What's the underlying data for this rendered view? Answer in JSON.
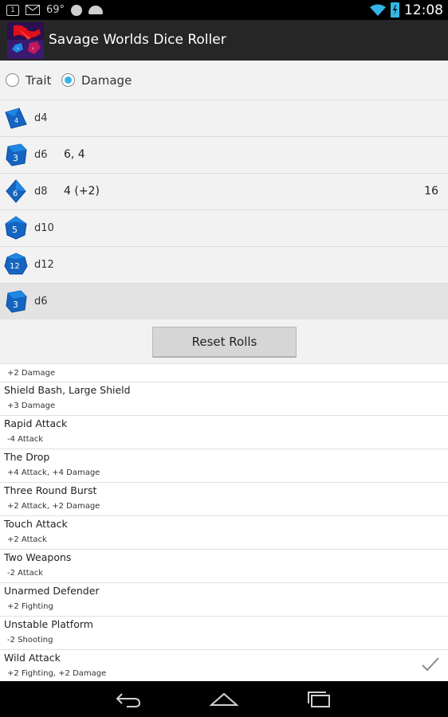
{
  "status_bar": {
    "notification_count": "1",
    "temperature": "69°",
    "time": "12:08",
    "icons": [
      "notification-badge-icon",
      "mail-icon",
      "hangouts-icon",
      "android-icon",
      "wifi-icon",
      "battery-charging-icon"
    ]
  },
  "app": {
    "title": "Savage Worlds Dice Roller",
    "icon": "app-logo-icon"
  },
  "mode": {
    "options": [
      {
        "label": "Trait",
        "selected": false
      },
      {
        "label": "Damage",
        "selected": true
      }
    ]
  },
  "dice": [
    {
      "name": "d4",
      "result": "",
      "total": "",
      "icon": "d4-die-icon",
      "face": "4"
    },
    {
      "name": "d6",
      "result": "6, 4",
      "total": "",
      "icon": "d6-die-icon",
      "face": "3"
    },
    {
      "name": "d8",
      "result": "4 (+2)",
      "total": "16",
      "icon": "d8-die-icon",
      "face": "6"
    },
    {
      "name": "d10",
      "result": "",
      "total": "",
      "icon": "d10-die-icon",
      "face": "5"
    },
    {
      "name": "d12",
      "result": "",
      "total": "",
      "icon": "d12-die-icon",
      "face": "12"
    },
    {
      "name": "d6",
      "result": "",
      "total": "",
      "icon": "d6-die-icon",
      "face": "3",
      "selected": true
    }
  ],
  "reset_label": "Reset Rolls",
  "modifiers": [
    {
      "title": "",
      "subtitle": "+2 Damage",
      "checked": false
    },
    {
      "title": "Shield Bash, Large Shield",
      "subtitle": "+3 Damage",
      "checked": false
    },
    {
      "title": "Rapid Attack",
      "subtitle": "-4 Attack",
      "checked": false
    },
    {
      "title": "The Drop",
      "subtitle": "+4 Attack, +4 Damage",
      "checked": false
    },
    {
      "title": "Three Round Burst",
      "subtitle": "+2 Attack, +2 Damage",
      "checked": false
    },
    {
      "title": "Touch Attack",
      "subtitle": "+2 Attack",
      "checked": false
    },
    {
      "title": "Two Weapons",
      "subtitle": "-2 Attack",
      "checked": false
    },
    {
      "title": "Unarmed Defender",
      "subtitle": "+2 Fighting",
      "checked": false
    },
    {
      "title": "Unstable Platform",
      "subtitle": "-2 Shooting",
      "checked": false
    },
    {
      "title": "Wild Attack",
      "subtitle": "+2 Fighting, +2 Damage",
      "checked": true
    }
  ],
  "colors": {
    "accent": "#33b5e5",
    "die_blue": "#1565c0",
    "action_bar": "#262626"
  }
}
